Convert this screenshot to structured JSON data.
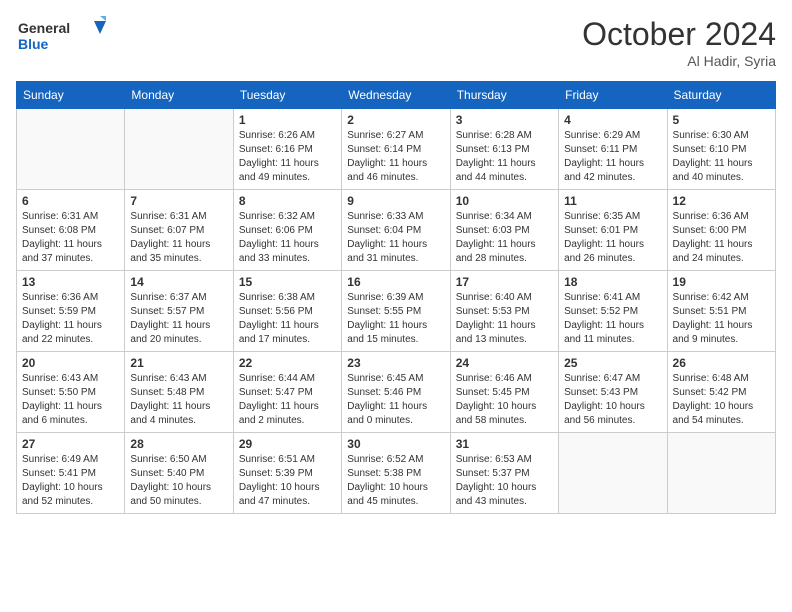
{
  "header": {
    "logo_general": "General",
    "logo_blue": "Blue",
    "month_title": "October 2024",
    "location": "Al Hadir, Syria"
  },
  "weekdays": [
    "Sunday",
    "Monday",
    "Tuesday",
    "Wednesday",
    "Thursday",
    "Friday",
    "Saturday"
  ],
  "weeks": [
    [
      {
        "day": "",
        "sunrise": "",
        "sunset": "",
        "daylight": ""
      },
      {
        "day": "",
        "sunrise": "",
        "sunset": "",
        "daylight": ""
      },
      {
        "day": "1",
        "sunrise": "Sunrise: 6:26 AM",
        "sunset": "Sunset: 6:16 PM",
        "daylight": "Daylight: 11 hours and 49 minutes."
      },
      {
        "day": "2",
        "sunrise": "Sunrise: 6:27 AM",
        "sunset": "Sunset: 6:14 PM",
        "daylight": "Daylight: 11 hours and 46 minutes."
      },
      {
        "day": "3",
        "sunrise": "Sunrise: 6:28 AM",
        "sunset": "Sunset: 6:13 PM",
        "daylight": "Daylight: 11 hours and 44 minutes."
      },
      {
        "day": "4",
        "sunrise": "Sunrise: 6:29 AM",
        "sunset": "Sunset: 6:11 PM",
        "daylight": "Daylight: 11 hours and 42 minutes."
      },
      {
        "day": "5",
        "sunrise": "Sunrise: 6:30 AM",
        "sunset": "Sunset: 6:10 PM",
        "daylight": "Daylight: 11 hours and 40 minutes."
      }
    ],
    [
      {
        "day": "6",
        "sunrise": "Sunrise: 6:31 AM",
        "sunset": "Sunset: 6:08 PM",
        "daylight": "Daylight: 11 hours and 37 minutes."
      },
      {
        "day": "7",
        "sunrise": "Sunrise: 6:31 AM",
        "sunset": "Sunset: 6:07 PM",
        "daylight": "Daylight: 11 hours and 35 minutes."
      },
      {
        "day": "8",
        "sunrise": "Sunrise: 6:32 AM",
        "sunset": "Sunset: 6:06 PM",
        "daylight": "Daylight: 11 hours and 33 minutes."
      },
      {
        "day": "9",
        "sunrise": "Sunrise: 6:33 AM",
        "sunset": "Sunset: 6:04 PM",
        "daylight": "Daylight: 11 hours and 31 minutes."
      },
      {
        "day": "10",
        "sunrise": "Sunrise: 6:34 AM",
        "sunset": "Sunset: 6:03 PM",
        "daylight": "Daylight: 11 hours and 28 minutes."
      },
      {
        "day": "11",
        "sunrise": "Sunrise: 6:35 AM",
        "sunset": "Sunset: 6:01 PM",
        "daylight": "Daylight: 11 hours and 26 minutes."
      },
      {
        "day": "12",
        "sunrise": "Sunrise: 6:36 AM",
        "sunset": "Sunset: 6:00 PM",
        "daylight": "Daylight: 11 hours and 24 minutes."
      }
    ],
    [
      {
        "day": "13",
        "sunrise": "Sunrise: 6:36 AM",
        "sunset": "Sunset: 5:59 PM",
        "daylight": "Daylight: 11 hours and 22 minutes."
      },
      {
        "day": "14",
        "sunrise": "Sunrise: 6:37 AM",
        "sunset": "Sunset: 5:57 PM",
        "daylight": "Daylight: 11 hours and 20 minutes."
      },
      {
        "day": "15",
        "sunrise": "Sunrise: 6:38 AM",
        "sunset": "Sunset: 5:56 PM",
        "daylight": "Daylight: 11 hours and 17 minutes."
      },
      {
        "day": "16",
        "sunrise": "Sunrise: 6:39 AM",
        "sunset": "Sunset: 5:55 PM",
        "daylight": "Daylight: 11 hours and 15 minutes."
      },
      {
        "day": "17",
        "sunrise": "Sunrise: 6:40 AM",
        "sunset": "Sunset: 5:53 PM",
        "daylight": "Daylight: 11 hours and 13 minutes."
      },
      {
        "day": "18",
        "sunrise": "Sunrise: 6:41 AM",
        "sunset": "Sunset: 5:52 PM",
        "daylight": "Daylight: 11 hours and 11 minutes."
      },
      {
        "day": "19",
        "sunrise": "Sunrise: 6:42 AM",
        "sunset": "Sunset: 5:51 PM",
        "daylight": "Daylight: 11 hours and 9 minutes."
      }
    ],
    [
      {
        "day": "20",
        "sunrise": "Sunrise: 6:43 AM",
        "sunset": "Sunset: 5:50 PM",
        "daylight": "Daylight: 11 hours and 6 minutes."
      },
      {
        "day": "21",
        "sunrise": "Sunrise: 6:43 AM",
        "sunset": "Sunset: 5:48 PM",
        "daylight": "Daylight: 11 hours and 4 minutes."
      },
      {
        "day": "22",
        "sunrise": "Sunrise: 6:44 AM",
        "sunset": "Sunset: 5:47 PM",
        "daylight": "Daylight: 11 hours and 2 minutes."
      },
      {
        "day": "23",
        "sunrise": "Sunrise: 6:45 AM",
        "sunset": "Sunset: 5:46 PM",
        "daylight": "Daylight: 11 hours and 0 minutes."
      },
      {
        "day": "24",
        "sunrise": "Sunrise: 6:46 AM",
        "sunset": "Sunset: 5:45 PM",
        "daylight": "Daylight: 10 hours and 58 minutes."
      },
      {
        "day": "25",
        "sunrise": "Sunrise: 6:47 AM",
        "sunset": "Sunset: 5:43 PM",
        "daylight": "Daylight: 10 hours and 56 minutes."
      },
      {
        "day": "26",
        "sunrise": "Sunrise: 6:48 AM",
        "sunset": "Sunset: 5:42 PM",
        "daylight": "Daylight: 10 hours and 54 minutes."
      }
    ],
    [
      {
        "day": "27",
        "sunrise": "Sunrise: 6:49 AM",
        "sunset": "Sunset: 5:41 PM",
        "daylight": "Daylight: 10 hours and 52 minutes."
      },
      {
        "day": "28",
        "sunrise": "Sunrise: 6:50 AM",
        "sunset": "Sunset: 5:40 PM",
        "daylight": "Daylight: 10 hours and 50 minutes."
      },
      {
        "day": "29",
        "sunrise": "Sunrise: 6:51 AM",
        "sunset": "Sunset: 5:39 PM",
        "daylight": "Daylight: 10 hours and 47 minutes."
      },
      {
        "day": "30",
        "sunrise": "Sunrise: 6:52 AM",
        "sunset": "Sunset: 5:38 PM",
        "daylight": "Daylight: 10 hours and 45 minutes."
      },
      {
        "day": "31",
        "sunrise": "Sunrise: 6:53 AM",
        "sunset": "Sunset: 5:37 PM",
        "daylight": "Daylight: 10 hours and 43 minutes."
      },
      {
        "day": "",
        "sunrise": "",
        "sunset": "",
        "daylight": ""
      },
      {
        "day": "",
        "sunrise": "",
        "sunset": "",
        "daylight": ""
      }
    ]
  ]
}
